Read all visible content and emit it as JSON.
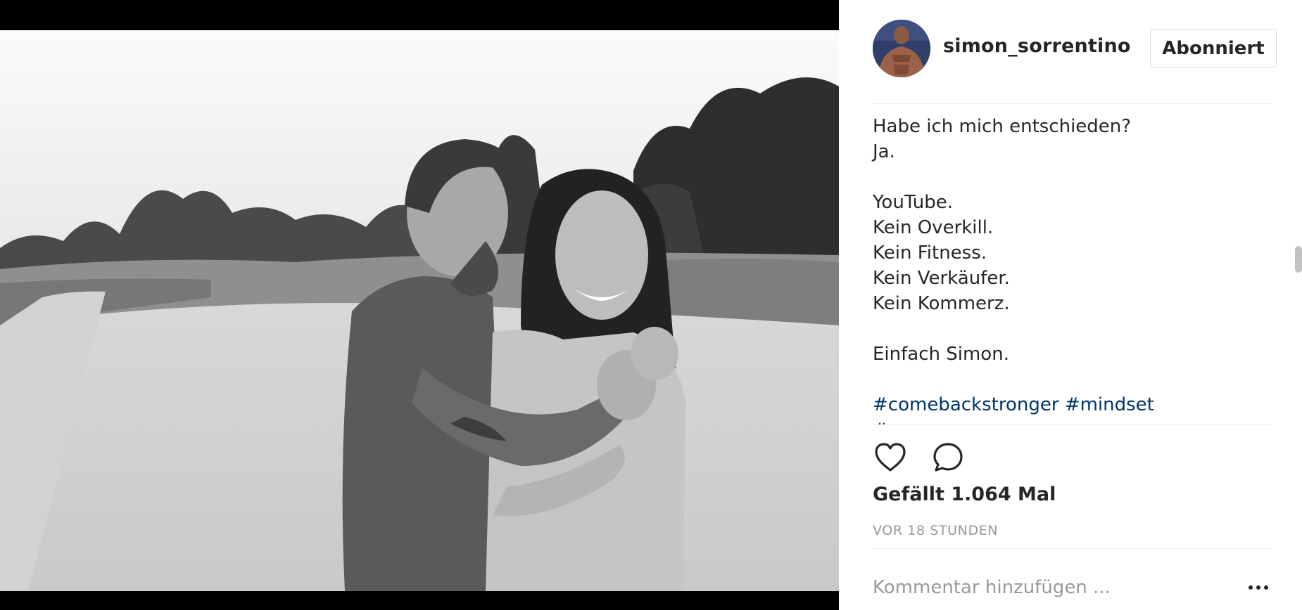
{
  "post": {
    "image": {
      "alt": "",
      "style": "black-and-white"
    },
    "author": {
      "username": "simon_sorrentino",
      "avatar_icon": "avatar-photo"
    },
    "follow_button_label": "Abonniert",
    "caption": {
      "lines": [
        "Habe ich mich entschieden?",
        "Ja.",
        "",
        "YouTube.",
        "Kein Overkill.",
        "Kein Fitness.",
        "Kein Verkäufer.",
        "Kein Kommerz.",
        "",
        "Einfach Simon.",
        ""
      ],
      "hashtags": [
        "#comebackstronger",
        "#mindset"
      ],
      "hashtags_continued": "#..."
    },
    "actions": {
      "like_icon": "heart-outline-icon",
      "comment_icon": "speech-bubble-icon"
    },
    "likes_text": "Gefällt 1.064 Mal",
    "timestamp": "VOR 18 STUNDEN",
    "comment_placeholder": "Kommentar hinzufügen ...",
    "more_options_icon": "ellipsis-icon"
  },
  "colors": {
    "text": "#262626",
    "muted": "#999999",
    "hashtag": "#003569",
    "border": "#dbdbdb",
    "divider": "#efefef",
    "letterbox": "#000000"
  }
}
